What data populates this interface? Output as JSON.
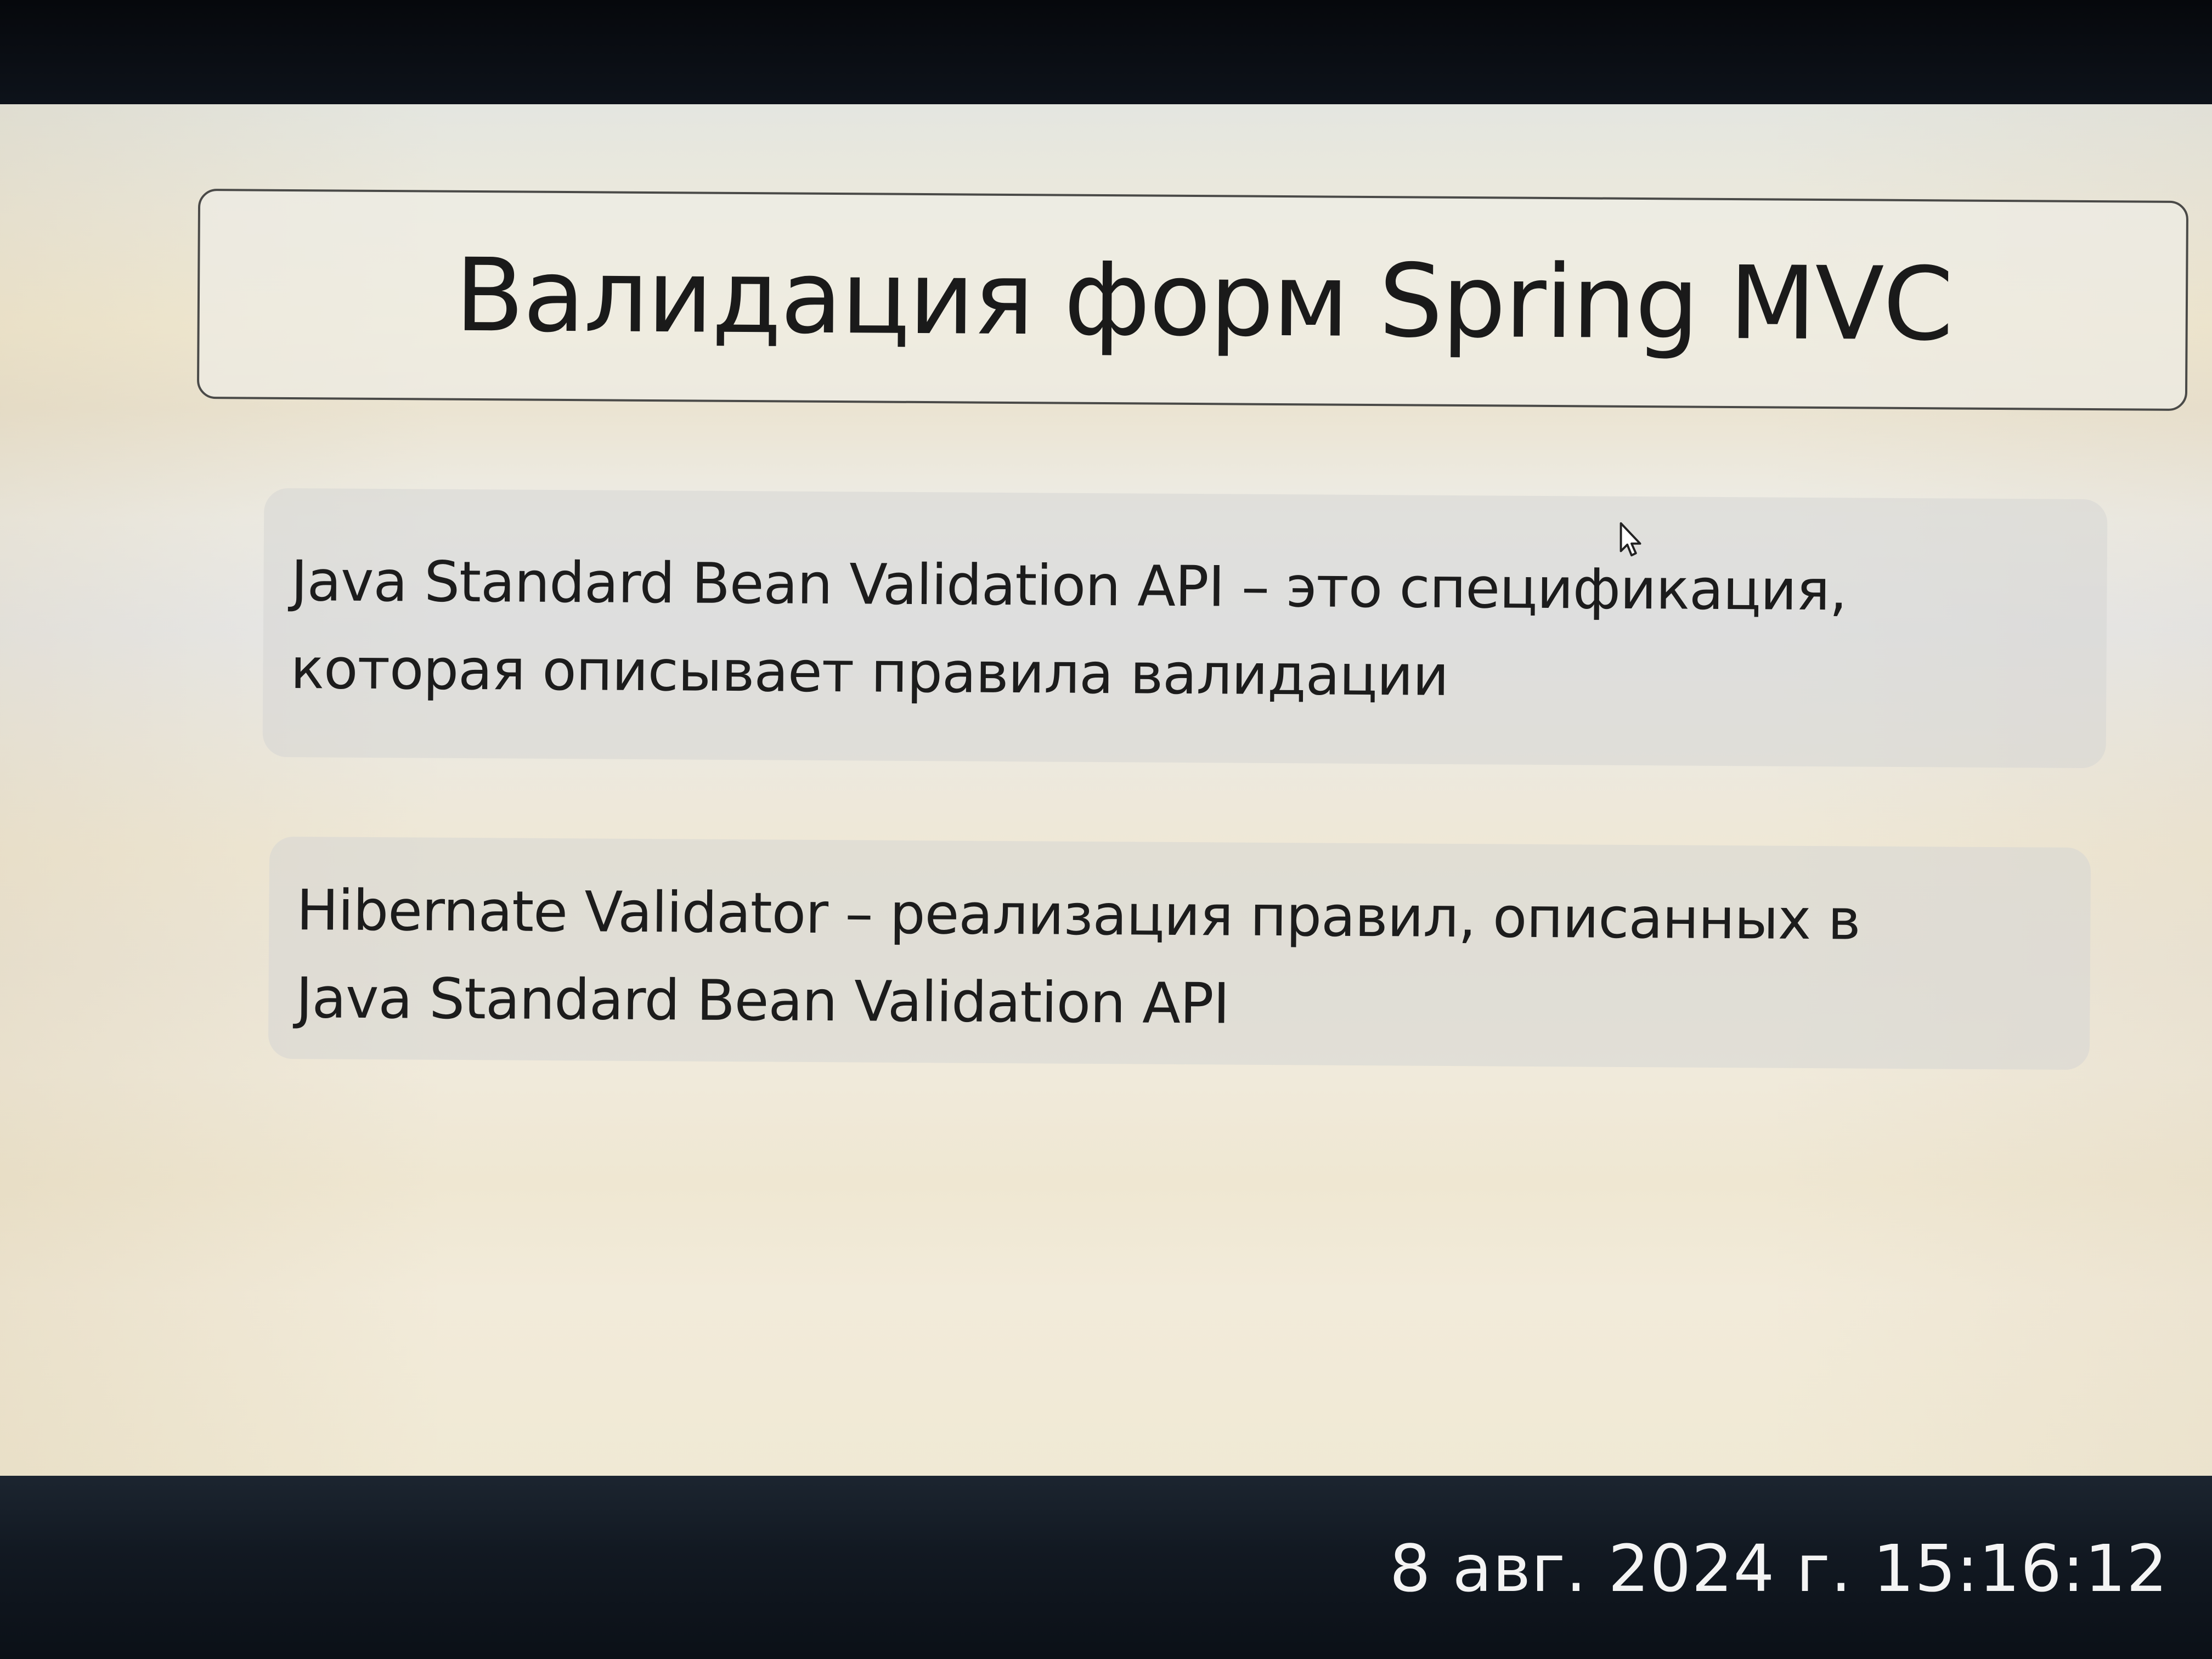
{
  "slide": {
    "title": "Валидация форм Spring MVC",
    "blocks": [
      {
        "line1": "Java Standard Bean Validation API – это спецификация,",
        "line2": "которая описывает правила валидации"
      },
      {
        "line1": "Hibernate Validator – реализация правил, описанных в",
        "line2": "Java Standard Bean Validation API"
      }
    ],
    "cursor_icon": "mouse-pointer-icon"
  },
  "photo": {
    "timestamp": "8 авг. 2024 г. 15:16:12"
  }
}
